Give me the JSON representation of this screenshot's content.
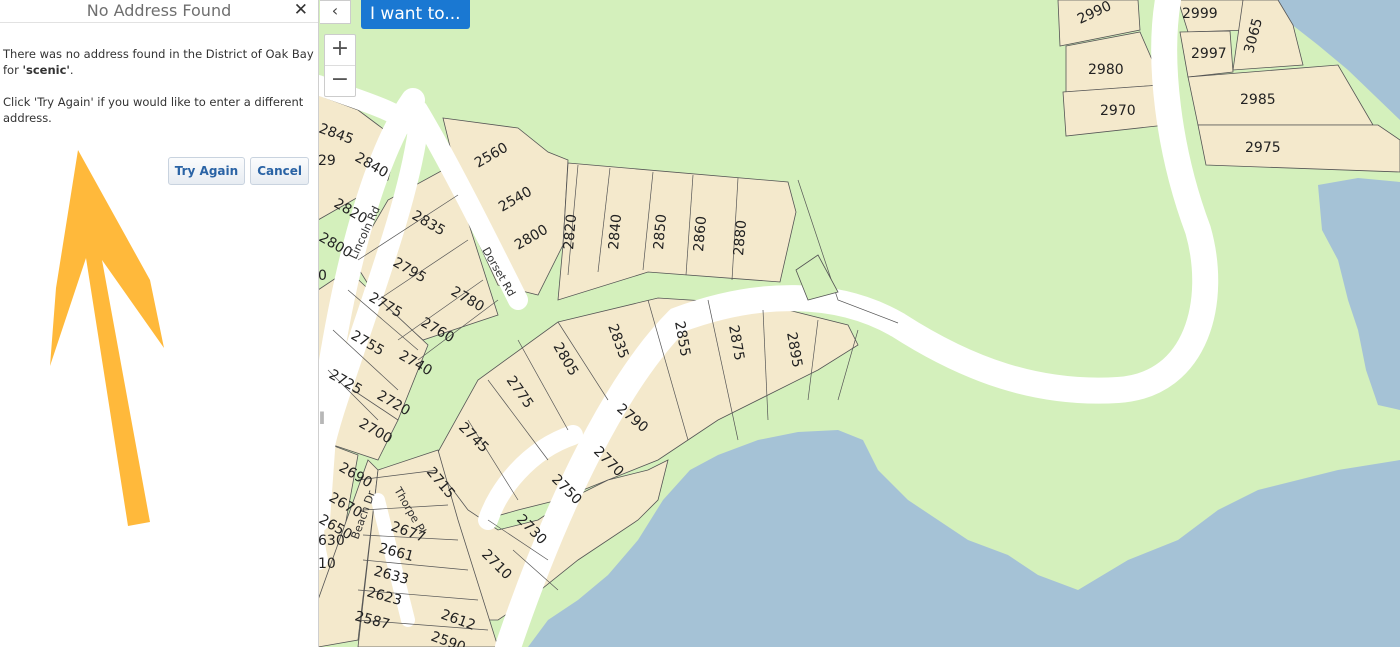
{
  "dialog": {
    "title": "No Address Found",
    "close_glyph": "✕",
    "message_prefix": "There was no address found in the District of Oak Bay for ",
    "search_term": "'scenic'",
    "message_suffix": ".",
    "hint": "Click 'Try Again' if you would like to enter a different address.",
    "try_again_label": "Try Again",
    "cancel_label": "Cancel"
  },
  "toolbar": {
    "collapse_glyph": "‹",
    "i_want_to_label": "I want to...",
    "zoom_in_glyph": "+",
    "zoom_out_glyph": "−",
    "splitter_glyph": "‖"
  },
  "colors": {
    "park": "#d4f0bc",
    "lot": "#f4e9cc",
    "water": "#a5c2d6",
    "road": "#ffffff",
    "accent": "#1a78d2",
    "arrow": "#ffb93b"
  },
  "map": {
    "roads": [
      "Lincoln Rd",
      "Dorset Rd",
      "Beach Dr",
      "Thorpe Pl"
    ],
    "lots": [
      "2990",
      "2999",
      "3065",
      "2997",
      "2980",
      "2970",
      "2985",
      "2975",
      "2845",
      "29",
      "2840",
      "2820",
      "2800",
      "0",
      "2835",
      "2795",
      "2775",
      "2760",
      "2780",
      "2755",
      "2740",
      "2725",
      "2720",
      "2700",
      "2690",
      "2670",
      "2650",
      "630",
      "10",
      "2677",
      "2661",
      "2633",
      "2623",
      "2587",
      "2612",
      "2590",
      "2560",
      "2540",
      "2800",
      "2820",
      "2840",
      "2850",
      "2860",
      "2880",
      "2835",
      "2805",
      "2855",
      "2875",
      "2895",
      "2775",
      "2790",
      "2745",
      "2770",
      "2715",
      "2750",
      "2730",
      "2710"
    ]
  }
}
